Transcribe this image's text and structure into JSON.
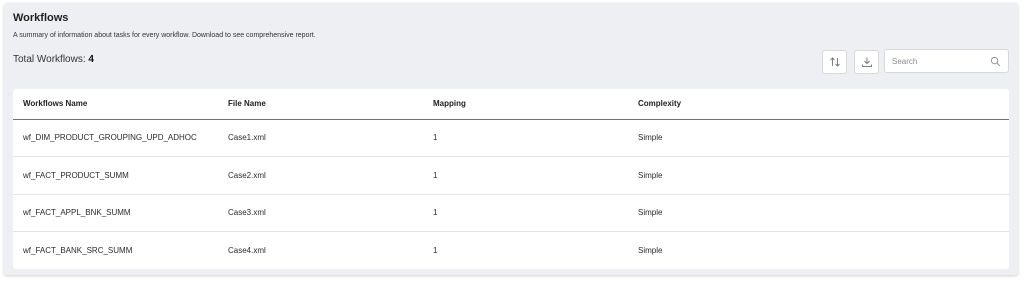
{
  "header": {
    "title": "Workflows",
    "subtitle": "A summary of information about tasks for every workflow. Download to see comprehensive report.",
    "total_label": "Total Workflows:",
    "total_value": "4"
  },
  "toolbar": {
    "sort_icon": "sort-arrows-icon",
    "download_icon": "download-icon",
    "search_placeholder": "Search",
    "search_value": ""
  },
  "table": {
    "columns": [
      "Workflows Name",
      "File Name",
      "Mapping",
      "Complexity"
    ],
    "rows": [
      [
        "wf_DIM_PRODUCT_GROUPING_UPD_ADHOC",
        "Case1.xml",
        "1",
        "Simple"
      ],
      [
        "wf_FACT_PRODUCT_SUMM",
        "Case2.xml",
        "1",
        "Simple"
      ],
      [
        "wf_FACT_APPL_BNK_SUMM",
        "Case3.xml",
        "1",
        "Simple"
      ],
      [
        "wf_FACT_BANK_SRC_SUMM",
        "Case4.xml",
        "1",
        "Simple"
      ]
    ]
  },
  "colors": {
    "panel_bg": "#eeeff2",
    "card_bg": "#ffffff",
    "header_divider": "#6f7278",
    "row_divider": "#e3e4e7"
  }
}
